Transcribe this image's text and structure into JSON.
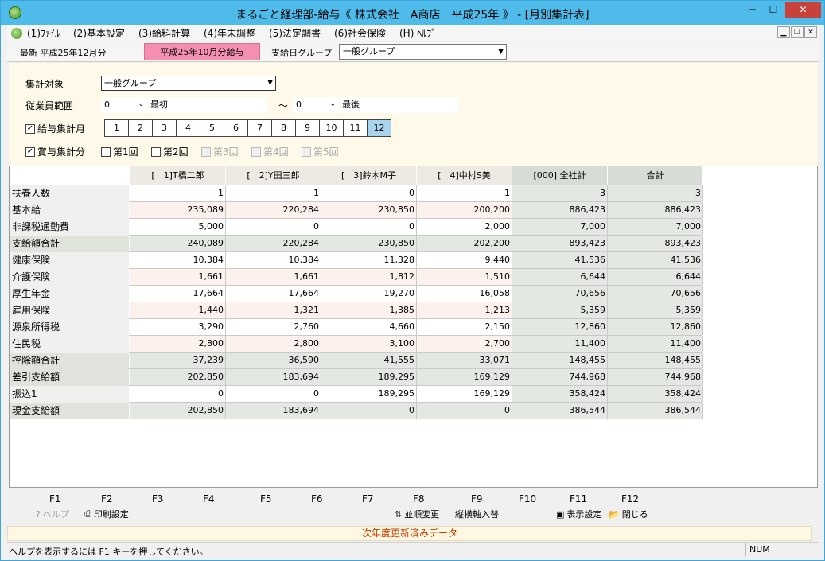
{
  "window": {
    "title": "まるごと経理部-給与《 株式会社　A商店　平成25年 》 - [月別集計表]",
    "min_label": "─",
    "max_label": "☐",
    "close_label": "✕"
  },
  "menu": [
    "(1)ﾌｧｲﾙ",
    "(2)基本設定",
    "(3)給料計算",
    "(4)年末調整",
    "(5)法定調書",
    "(6)社会保険",
    "(H) ﾍﾙﾌﾟ"
  ],
  "info": {
    "latest": "最新 平成25年12月分",
    "current_month": "平成25年10月分給与",
    "pay_group_label": "支給日グループ",
    "pay_group_value": "一般グループ"
  },
  "filter": {
    "target_label": "集計対象",
    "target_value": "一般グループ",
    "range_label": "従業員範囲",
    "from_code": "0",
    "from_name": "最初",
    "tilde": "～",
    "to_code": "0",
    "to_name": "最後",
    "salary_label": "給与集計月",
    "salary_checked": true,
    "months": [
      "1",
      "2",
      "3",
      "4",
      "5",
      "6",
      "7",
      "8",
      "9",
      "10",
      "11",
      "12"
    ],
    "active_month": "12",
    "bonus_label": "賞与集計分",
    "bonus_checked": true,
    "bonus_rounds": [
      {
        "label": "第1回",
        "enabled": true
      },
      {
        "label": "第2回",
        "enabled": true
      },
      {
        "label": "第3回",
        "enabled": false
      },
      {
        "label": "第4回",
        "enabled": false
      },
      {
        "label": "第5回",
        "enabled": false
      }
    ]
  },
  "grid": {
    "headers": [
      "[　1]T橋二郎",
      "[　2]Y田三郎",
      "[　3]鈴木M子",
      "[　4]中村S美",
      "[000] 全社計",
      "合計"
    ],
    "rows": [
      {
        "label": "扶養人数",
        "values": [
          "1",
          "1",
          "0",
          "1",
          "3",
          "3"
        ]
      },
      {
        "label": "基本給",
        "values": [
          "235,089",
          "220,284",
          "230,850",
          "200,200",
          "886,423",
          "886,423"
        ]
      },
      {
        "label": "非課税通勤費",
        "values": [
          "5,000",
          "0",
          "0",
          "2,000",
          "7,000",
          "7,000"
        ]
      },
      {
        "label": "支給額合計",
        "values": [
          "240,089",
          "220,284",
          "230,850",
          "202,200",
          "893,423",
          "893,423"
        ],
        "shade": true
      },
      {
        "label": "健康保険",
        "values": [
          "10,384",
          "10,384",
          "11,328",
          "9,440",
          "41,536",
          "41,536"
        ]
      },
      {
        "label": "介護保険",
        "values": [
          "1,661",
          "1,661",
          "1,812",
          "1,510",
          "6,644",
          "6,644"
        ]
      },
      {
        "label": "厚生年金",
        "values": [
          "17,664",
          "17,664",
          "19,270",
          "16,058",
          "70,656",
          "70,656"
        ]
      },
      {
        "label": "雇用保険",
        "values": [
          "1,440",
          "1,321",
          "1,385",
          "1,213",
          "5,359",
          "5,359"
        ]
      },
      {
        "label": "源泉所得税",
        "values": [
          "3,290",
          "2,760",
          "4,660",
          "2,150",
          "12,860",
          "12,860"
        ]
      },
      {
        "label": "住民税",
        "values": [
          "2,800",
          "2,800",
          "3,100",
          "2,700",
          "11,400",
          "11,400"
        ]
      },
      {
        "label": "控除額合計",
        "values": [
          "37,239",
          "36,590",
          "41,555",
          "33,071",
          "148,455",
          "148,455"
        ],
        "shade": true
      },
      {
        "label": "差引支給額",
        "values": [
          "202,850",
          "183,694",
          "189,295",
          "169,129",
          "744,968",
          "744,968"
        ],
        "shade": true
      },
      {
        "label": "振込1",
        "values": [
          "0",
          "0",
          "189,295",
          "169,129",
          "358,424",
          "358,424"
        ]
      },
      {
        "label": "現金支給額",
        "values": [
          "202,850",
          "183,694",
          "0",
          "0",
          "386,544",
          "386,544"
        ],
        "shade": true
      }
    ]
  },
  "fkeys": [
    "F1",
    "F2",
    "F3",
    "F4",
    "F5",
    "F6",
    "F7",
    "F8",
    "F9",
    "F10",
    "F11",
    "F12"
  ],
  "fkey_actions": {
    "help": {
      "label": "ヘルプ",
      "icon": "help-icon"
    },
    "print": {
      "label": "印刷設定",
      "icon": "printer-icon"
    },
    "sort": {
      "label": "並順変更",
      "icon": "sort-icon"
    },
    "axis": {
      "label": "縦横軸入替"
    },
    "display": {
      "label": "表示設定",
      "icon": "display-settings-icon"
    },
    "close": {
      "label": "閉じる",
      "icon": "folder-open-icon"
    }
  },
  "notice": "次年度更新済みデータ",
  "status": {
    "text": "ヘルプを表示するには F1 キーを押してください。",
    "num": "NUM"
  },
  "colors": {
    "title_bar": "#4fbbeb",
    "month_tag": "#f48fb1",
    "filter_bg": "#fef9e9",
    "notice_text": "#c33c00"
  }
}
